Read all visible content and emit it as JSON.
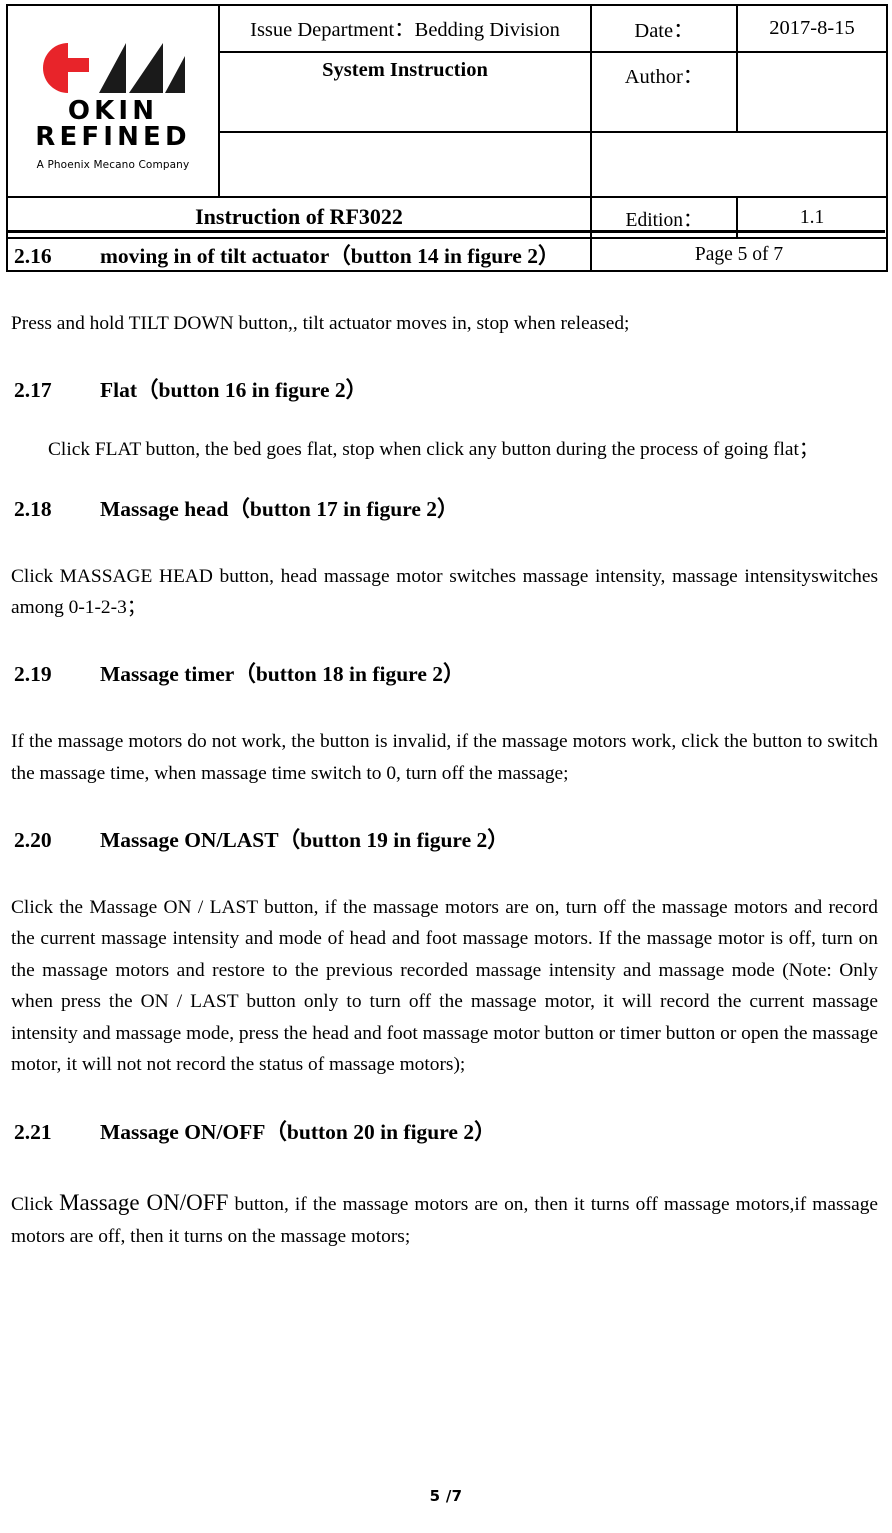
{
  "header": {
    "logo": {
      "word_line_1": "OKIN",
      "word_line_2": "REFINED",
      "tagline": "A Phoenix Mecano Company",
      "mark_red": "#E8242A",
      "mark_black": "#1A1A1A"
    },
    "issue_department": "Issue Department：Bedding Division",
    "doc_type": "System Instruction",
    "blank_left": "",
    "blank_right": "",
    "date_label": "Date：",
    "date_value": "2017-8-15",
    "author_label": "Author：",
    "author_value": "",
    "title": "Instruction of RF3022",
    "edition_label": "Edition：",
    "edition_value": "1.1",
    "page_indicator": "Page 5 of 7"
  },
  "sections": [
    {
      "number": "2.16",
      "heading": "moving in of tilt actuator（button 14 in figure 2）",
      "body": "Press and hold TILT DOWN button,, tilt actuator moves in, stop when released;"
    },
    {
      "number": "2.17",
      "heading": "Flat（button 16 in figure 2）",
      "body": "Click FLAT button, the bed goes flat, stop when click any button during the process of going flat；"
    },
    {
      "number": "2.18",
      "heading": "Massage head（button 17 in figure 2）",
      "body": "Click MASSAGE HEAD button, head massage motor switches massage intensity, massage intensityswitches among 0-1-2-3；"
    },
    {
      "number": "2.19",
      "heading": "Massage timer（button 18 in figure 2）",
      "body": "If the massage motors do not work, the button is invalid, if the massage motors work, click the button to switch the massage time, when massage time switch to 0, turn off the massage;"
    },
    {
      "number": "2.20",
      "heading": "Massage ON/LAST（button 19 in figure 2）",
      "body": "Click the Massage ON / LAST button, if the massage motors are on, turn off the massage motors and record the current massage intensity and mode of head and foot massage motors. If the massage motor is off, turn on the massage motors and restore to the previous recorded massage intensity and massage mode (Note: Only when press the ON / LAST button only to turn off the massage motor, it will record the current massage intensity and massage mode, press the head and foot massage motor button or timer button or open the massage motor, it will not not record the status of massage motors);"
    },
    {
      "number": "2.21",
      "heading": "Massage ON/OFF（button 20 in figure 2）",
      "body_lead": "Click ",
      "body_emph": "Massage ON/OFF",
      "body_rest": " button, if the massage motors are on, then it turns off massage motors,if massage motors are off, then it turns on the massage motors;"
    }
  ],
  "footer": {
    "page_number": "5 /7"
  }
}
